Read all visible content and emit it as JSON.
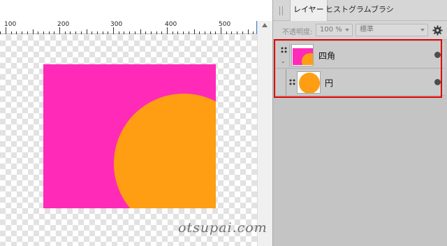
{
  "ruler": {
    "labels": [
      "100",
      "200",
      "300",
      "400",
      "500"
    ]
  },
  "canvas": {
    "colors": {
      "rect": "#ff2ab8",
      "circle": "#ff9e13",
      "checker": "#e2e2e2"
    },
    "watermark": "otsupai.com"
  },
  "panel": {
    "tabs": [
      {
        "label": "レイヤー",
        "active": true
      },
      {
        "label": "ヒストグラム",
        "active": false
      },
      {
        "label": "ブラシ",
        "active": false
      }
    ],
    "opacity_label": "不透明度:",
    "opacity_value": "100 %",
    "blend_mode": "標準",
    "layers": [
      {
        "name": "四角",
        "thumb": "rect-with-circle"
      },
      {
        "name": "円",
        "thumb": "circle"
      }
    ],
    "highlight_color": "#e00000"
  }
}
